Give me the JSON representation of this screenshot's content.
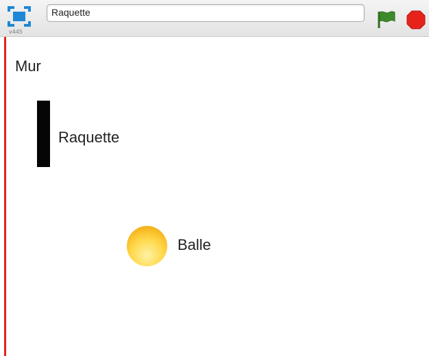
{
  "toolbar": {
    "version_label": "v445",
    "project_title": "Raquette",
    "icons": {
      "presentation_mode": "fullscreen-icon",
      "green_flag": "green-flag-icon",
      "stop": "stop-sign-icon"
    },
    "colors": {
      "presentation_icon": "#1e88d6",
      "flag": "#3f8a2a",
      "stop": "#e5231b"
    }
  },
  "stage": {
    "sprites": {
      "wall_label": "Mur",
      "paddle_label": "Raquette",
      "ball_label": "Balle"
    },
    "colors": {
      "wall": "#e0241a",
      "paddle": "#050505",
      "ball": "#ffd84a"
    }
  }
}
